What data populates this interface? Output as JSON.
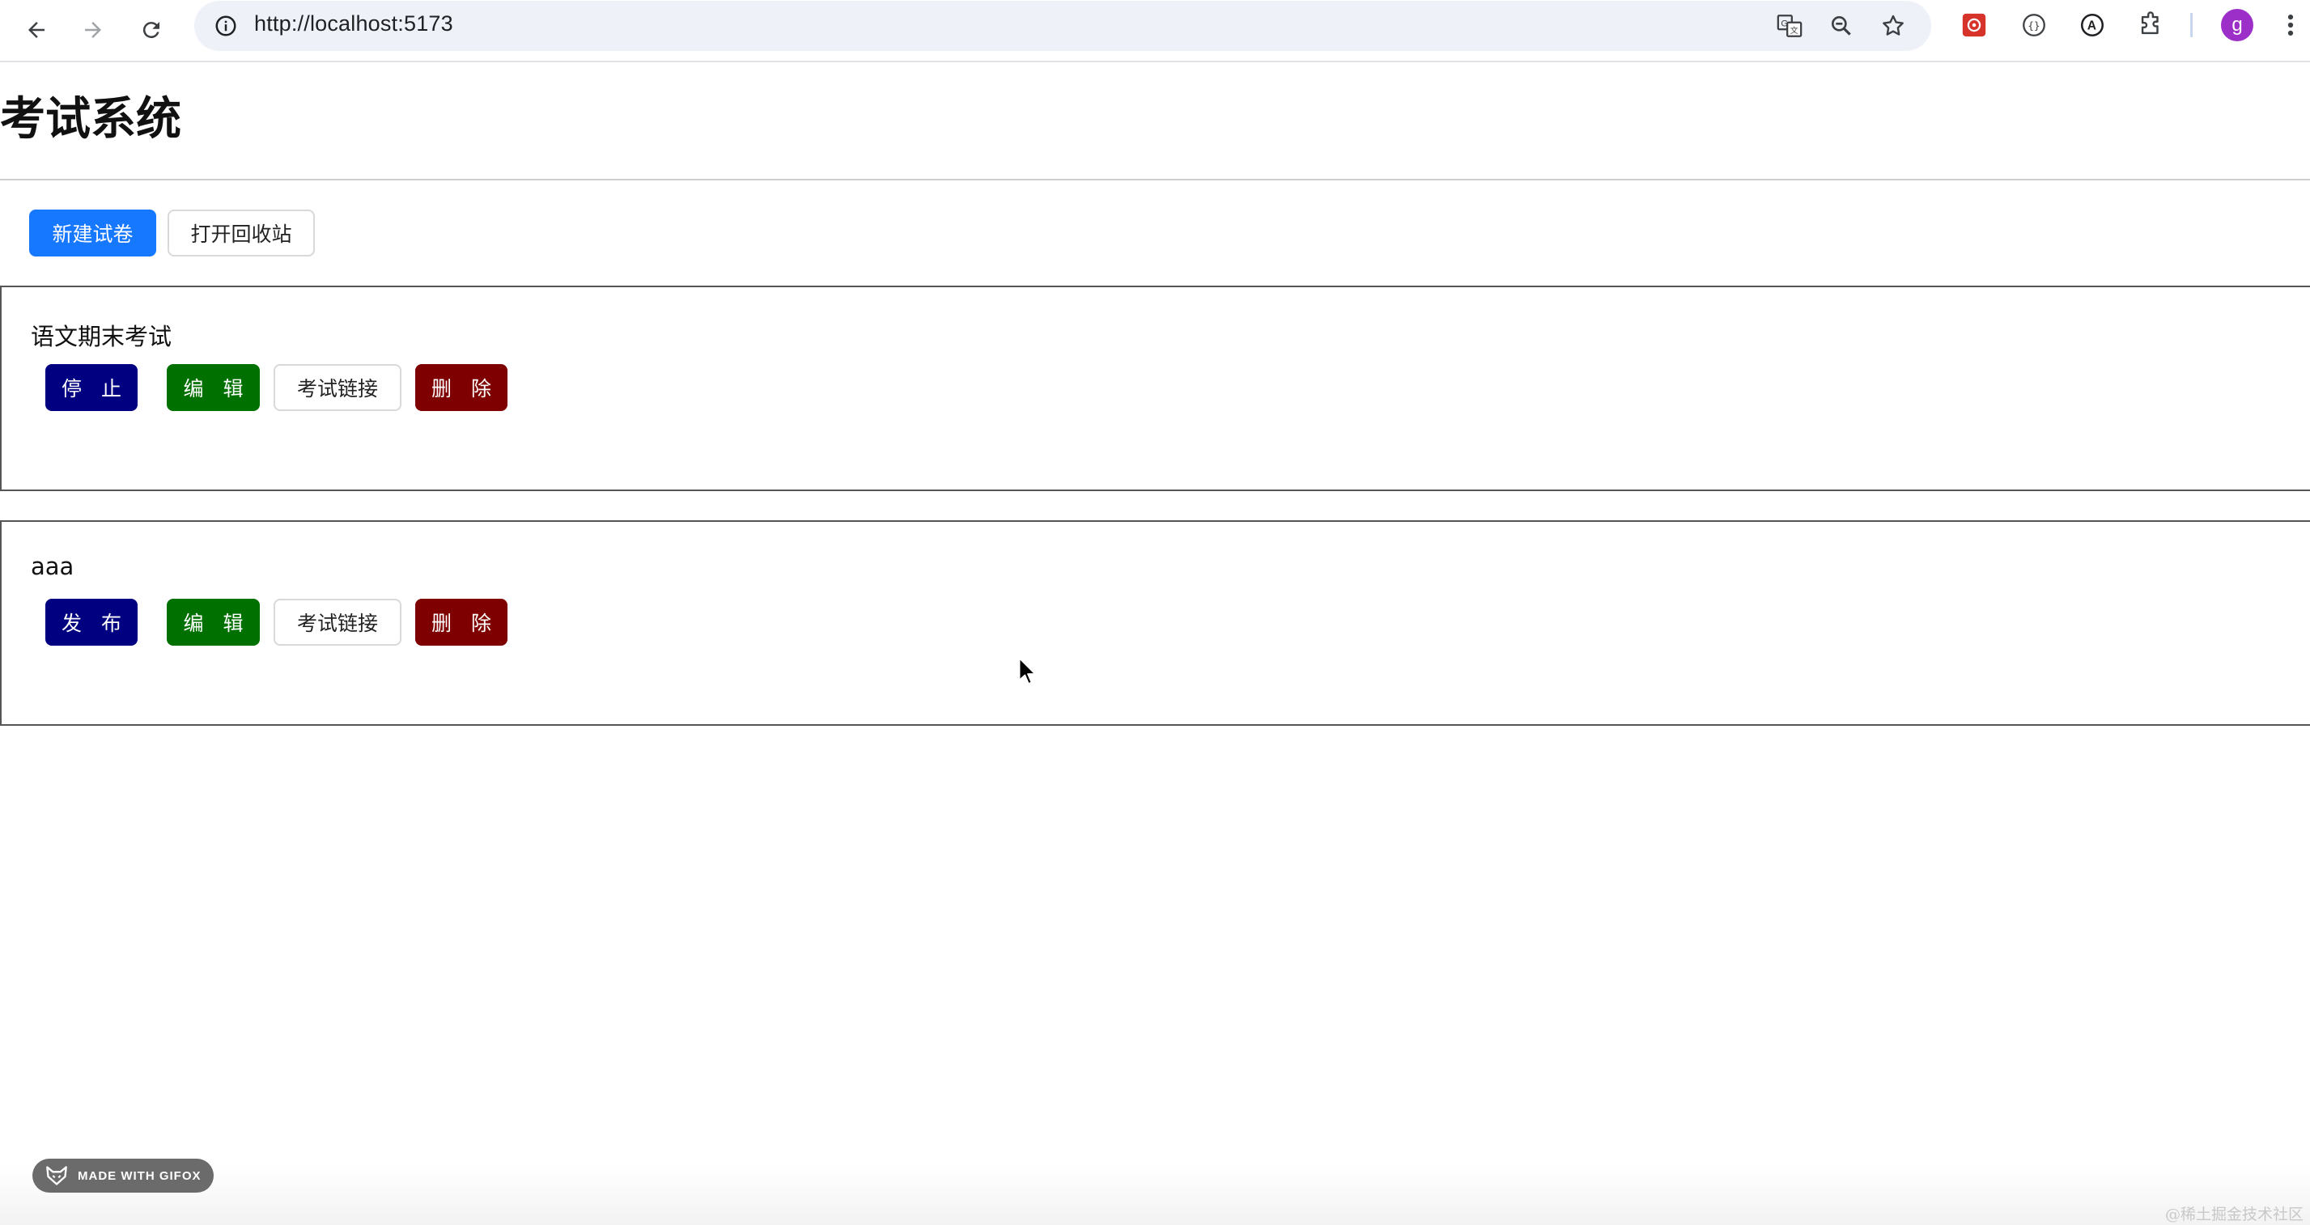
{
  "browser": {
    "url": "http://localhost:5173"
  },
  "page": {
    "title": "考试系统"
  },
  "toolbar": {
    "new_exam_label": "新建试卷",
    "recycle_bin_label": "打开回收站"
  },
  "exams": [
    {
      "name": "语文期末考试",
      "toggle_label": "停 止",
      "edit_label": "编 辑",
      "link_label": "考试链接",
      "delete_label": "删 除"
    },
    {
      "name": "aaa",
      "toggle_label": "发 布",
      "edit_label": "编 辑",
      "link_label": "考试链接",
      "delete_label": "删 除"
    }
  ],
  "overlay": {
    "gifox_badge": "MADE WITH GIFOX",
    "watermark": "@稀土掘金技术社区"
  },
  "colors": {
    "primary": "#1677ff",
    "navy": "#000080",
    "green": "#007000",
    "red": "#7f0000"
  }
}
